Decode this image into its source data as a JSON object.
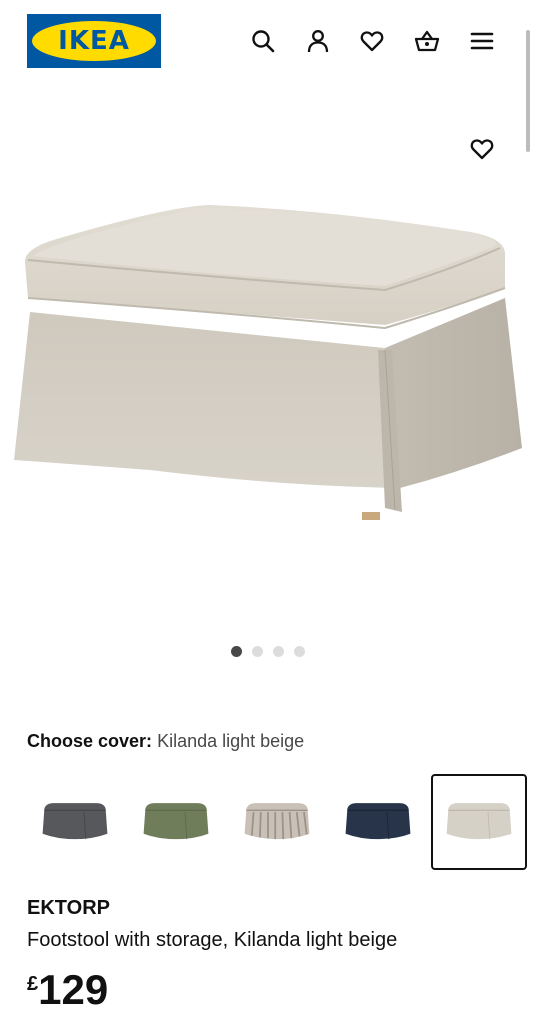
{
  "header": {
    "logo_text": "IKEA",
    "icons": [
      "search-icon",
      "account-icon",
      "wishlist-icon",
      "basket-icon",
      "menu-icon"
    ]
  },
  "product": {
    "favourite_icon": "heart-icon",
    "image_dots": {
      "count": 4,
      "active_index": 0
    },
    "choose_cover_label": "Choose cover:",
    "choose_cover_value": "Kilanda light beige",
    "swatches": [
      {
        "name": "dark grey",
        "color": "#56585b",
        "selected": false
      },
      {
        "name": "green",
        "color": "#6f7d5b",
        "selected": false
      },
      {
        "name": "striped beige",
        "color": "#b7aea4",
        "selected": false
      },
      {
        "name": "dark blue",
        "color": "#27344a",
        "selected": false
      },
      {
        "name": "Kilanda light beige",
        "color": "#d6d1c6",
        "selected": true
      }
    ],
    "brand": "EKTORP",
    "description": "Footstool with storage, Kilanda light beige",
    "price_currency": "£",
    "price_amount": "129"
  },
  "colors": {
    "ikea_blue": "#0058a3",
    "ikea_yellow": "#ffdb00",
    "fabric_beige": "#d6d1c6"
  }
}
